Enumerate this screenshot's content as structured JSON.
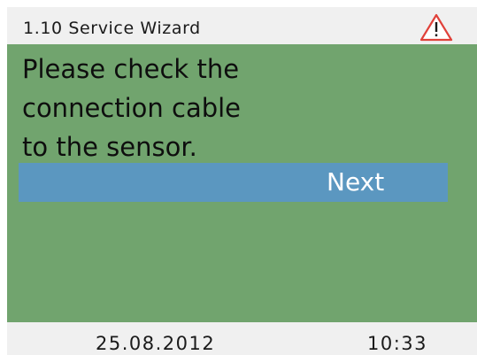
{
  "header": {
    "title": "1.10 Service Wizard",
    "alert_icon": "warning-triangle-icon",
    "alert_color": "#e0413a"
  },
  "message": {
    "lines": [
      "Please check the",
      "connection cable",
      "to the sensor."
    ]
  },
  "actions": {
    "next_label": "Next"
  },
  "footer": {
    "date": "25.08.2012",
    "time": "10:33"
  },
  "colors": {
    "content_background": "#71a46e",
    "selected_button": "#5b97c0",
    "header_footer_background": "#f0f0f0"
  }
}
